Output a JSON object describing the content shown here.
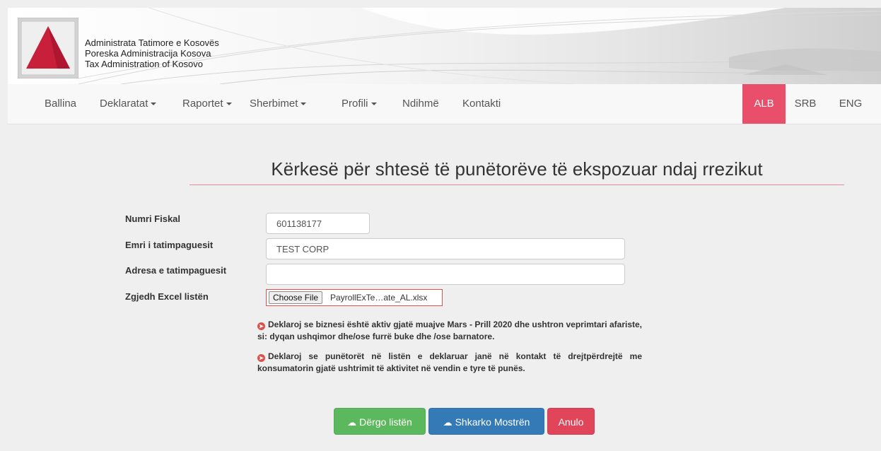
{
  "header": {
    "org_lines": [
      "Administrata Tatimore e Kosovës",
      "Poreska Administracija Kosova",
      "Tax Administration of Kosovo"
    ]
  },
  "nav": {
    "items": [
      {
        "label": "Ballina",
        "dropdown": false
      },
      {
        "label": "Deklaratat",
        "dropdown": true
      },
      {
        "label": "Raportet",
        "dropdown": true
      },
      {
        "label": "Sherbimet",
        "dropdown": true
      },
      {
        "label": "Profili",
        "dropdown": true
      },
      {
        "label": "Ndihmë",
        "dropdown": false
      },
      {
        "label": "Kontakti",
        "dropdown": false
      }
    ],
    "languages": [
      {
        "label": "ALB",
        "active": true
      },
      {
        "label": "SRB",
        "active": false
      },
      {
        "label": "ENG",
        "active": false
      }
    ],
    "active_color": "#e94f6b"
  },
  "form": {
    "title": "Kërkesë për shtesë të punëtorëve të ekspozuar ndaj rrezikut",
    "fiscal_number": {
      "label": "Numri Fiskal",
      "value": "601138177"
    },
    "taxpayer_name": {
      "label": "Emri i tatimpaguesit",
      "value": "TEST CORP"
    },
    "taxpayer_address": {
      "label": "Adresa e tatimpaguesit",
      "value": ""
    },
    "excel_file": {
      "label": "Zgjedh Excel listën",
      "button": "Choose File",
      "file_name": "PayrollExTe…ate_AL.xlsx"
    },
    "declarations": [
      "Deklaroj se biznesi është aktiv gjatë muajve Mars - Prill 2020 dhe ushtron veprimtari afariste, si: dyqan ushqimor dhe/ose furrë buke dhe /ose barnatore.",
      "Deklaroj se punëtorët në listën e deklaruar janë në kontakt të drejtpërdrejtë me konsumatorin gjatë ushtrimit të aktivitet në vendin e tyre të punës."
    ],
    "buttons": {
      "send": "Dërgo listën",
      "download": "Shkarko Mostrën",
      "cancel": "Anulo"
    }
  }
}
